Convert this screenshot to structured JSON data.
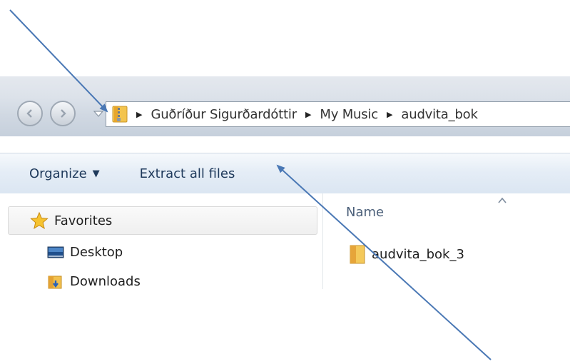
{
  "addressbar": {
    "path": [
      "Guðríður Sigurðardóttir",
      "My Music",
      "audvita_bok"
    ]
  },
  "toolbar": {
    "organize_label": "Organize",
    "extract_label": "Extract all files"
  },
  "navpane": {
    "favorites_label": "Favorites",
    "items": [
      {
        "label": "Desktop"
      },
      {
        "label": "Downloads"
      }
    ]
  },
  "filelist": {
    "column_name": "Name",
    "files": [
      {
        "name": "audvita_bok_3"
      }
    ]
  },
  "colors": {
    "annotation_arrow": "#4a78b5",
    "toolbar_text": "#1e395b",
    "column_header_text": "#4c607a"
  }
}
